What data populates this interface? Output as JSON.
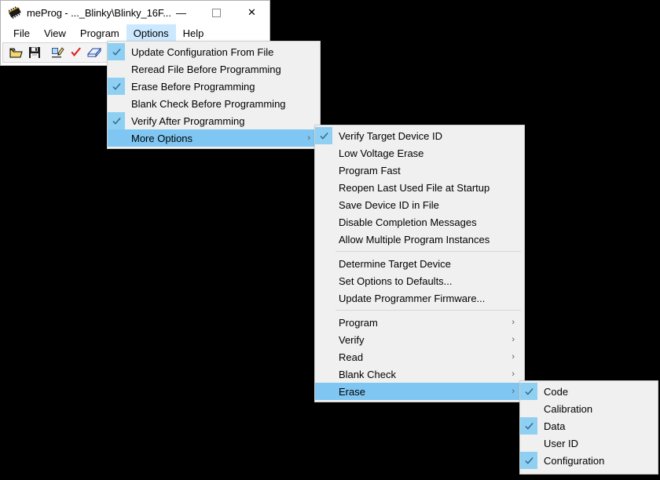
{
  "window": {
    "title": "meProg - ..._Blinky\\Blinky_16F...",
    "icon": "chip-icon",
    "buttons": {
      "minimize": "—",
      "maximize": "maximize-square",
      "close": "✕"
    },
    "menubar": [
      {
        "label": "File",
        "active": false
      },
      {
        "label": "View",
        "active": false
      },
      {
        "label": "Program",
        "active": false
      },
      {
        "label": "Options",
        "active": true
      },
      {
        "label": "Help",
        "active": false
      }
    ],
    "toolbar": [
      {
        "name": "open-file-icon",
        "title": "Open"
      },
      {
        "name": "save-file-icon",
        "title": "Save"
      },
      {
        "name": "program-device-icon",
        "title": "Program"
      },
      {
        "name": "verify-icon",
        "title": "Verify"
      },
      {
        "name": "erase-icon",
        "title": "Erase"
      },
      {
        "name": "blank-check-icon",
        "title": "Blank Check"
      }
    ]
  },
  "menu_options": {
    "name": "options-menu",
    "items": [
      {
        "label": "Update Configuration From File",
        "checked": true,
        "selected": false,
        "submenu": false
      },
      {
        "label": "Reread File Before Programming",
        "checked": false,
        "selected": false,
        "submenu": false
      },
      {
        "label": "Erase Before Programming",
        "checked": true,
        "selected": false,
        "submenu": false
      },
      {
        "label": "Blank Check Before Programming",
        "checked": false,
        "selected": false,
        "submenu": false
      },
      {
        "label": "Verify After Programming",
        "checked": true,
        "selected": false,
        "submenu": false
      },
      {
        "label": "More Options",
        "checked": false,
        "selected": true,
        "submenu": true
      }
    ]
  },
  "menu_more_options": {
    "name": "more-options-submenu",
    "groups": [
      {
        "items": [
          {
            "label": "Verify Target Device ID",
            "checked": true,
            "selected": false,
            "submenu": false
          },
          {
            "label": "Low Voltage Erase",
            "checked": false,
            "selected": false,
            "submenu": false
          },
          {
            "label": "Program Fast",
            "checked": false,
            "selected": false,
            "submenu": false
          },
          {
            "label": "Reopen Last Used File at Startup",
            "checked": false,
            "selected": false,
            "submenu": false
          },
          {
            "label": "Save Device ID in File",
            "checked": false,
            "selected": false,
            "submenu": false
          },
          {
            "label": "Disable Completion Messages",
            "checked": false,
            "selected": false,
            "submenu": false
          },
          {
            "label": "Allow Multiple Program Instances",
            "checked": false,
            "selected": false,
            "submenu": false
          }
        ]
      },
      {
        "items": [
          {
            "label": "Determine Target Device",
            "checked": false,
            "selected": false,
            "submenu": false
          },
          {
            "label": "Set Options to Defaults...",
            "checked": false,
            "selected": false,
            "submenu": false
          },
          {
            "label": "Update Programmer Firmware...",
            "checked": false,
            "selected": false,
            "submenu": false
          }
        ]
      },
      {
        "items": [
          {
            "label": "Program",
            "checked": false,
            "selected": false,
            "submenu": true
          },
          {
            "label": "Verify",
            "checked": false,
            "selected": false,
            "submenu": true
          },
          {
            "label": "Read",
            "checked": false,
            "selected": false,
            "submenu": true
          },
          {
            "label": "Blank Check",
            "checked": false,
            "selected": false,
            "submenu": true
          },
          {
            "label": "Erase",
            "checked": false,
            "selected": true,
            "submenu": true
          }
        ]
      }
    ]
  },
  "menu_erase": {
    "name": "erase-submenu",
    "items": [
      {
        "label": "Code",
        "checked": true,
        "selected": false,
        "submenu": false
      },
      {
        "label": "Calibration",
        "checked": false,
        "selected": false,
        "submenu": false
      },
      {
        "label": "Data",
        "checked": true,
        "selected": false,
        "submenu": false
      },
      {
        "label": "User ID",
        "checked": false,
        "selected": false,
        "submenu": false
      },
      {
        "label": "Configuration",
        "checked": true,
        "selected": false,
        "submenu": false
      }
    ]
  },
  "colors": {
    "menu_background": "#f0f0f0",
    "selection_blue": "#7fc6f2",
    "check_highlight": "#8fd0f2",
    "menubar_active": "#cce8ff",
    "desktop": "#000000"
  },
  "glyphs": {
    "submenu_arrow": "›",
    "checkmark": "checkmark-icon"
  }
}
